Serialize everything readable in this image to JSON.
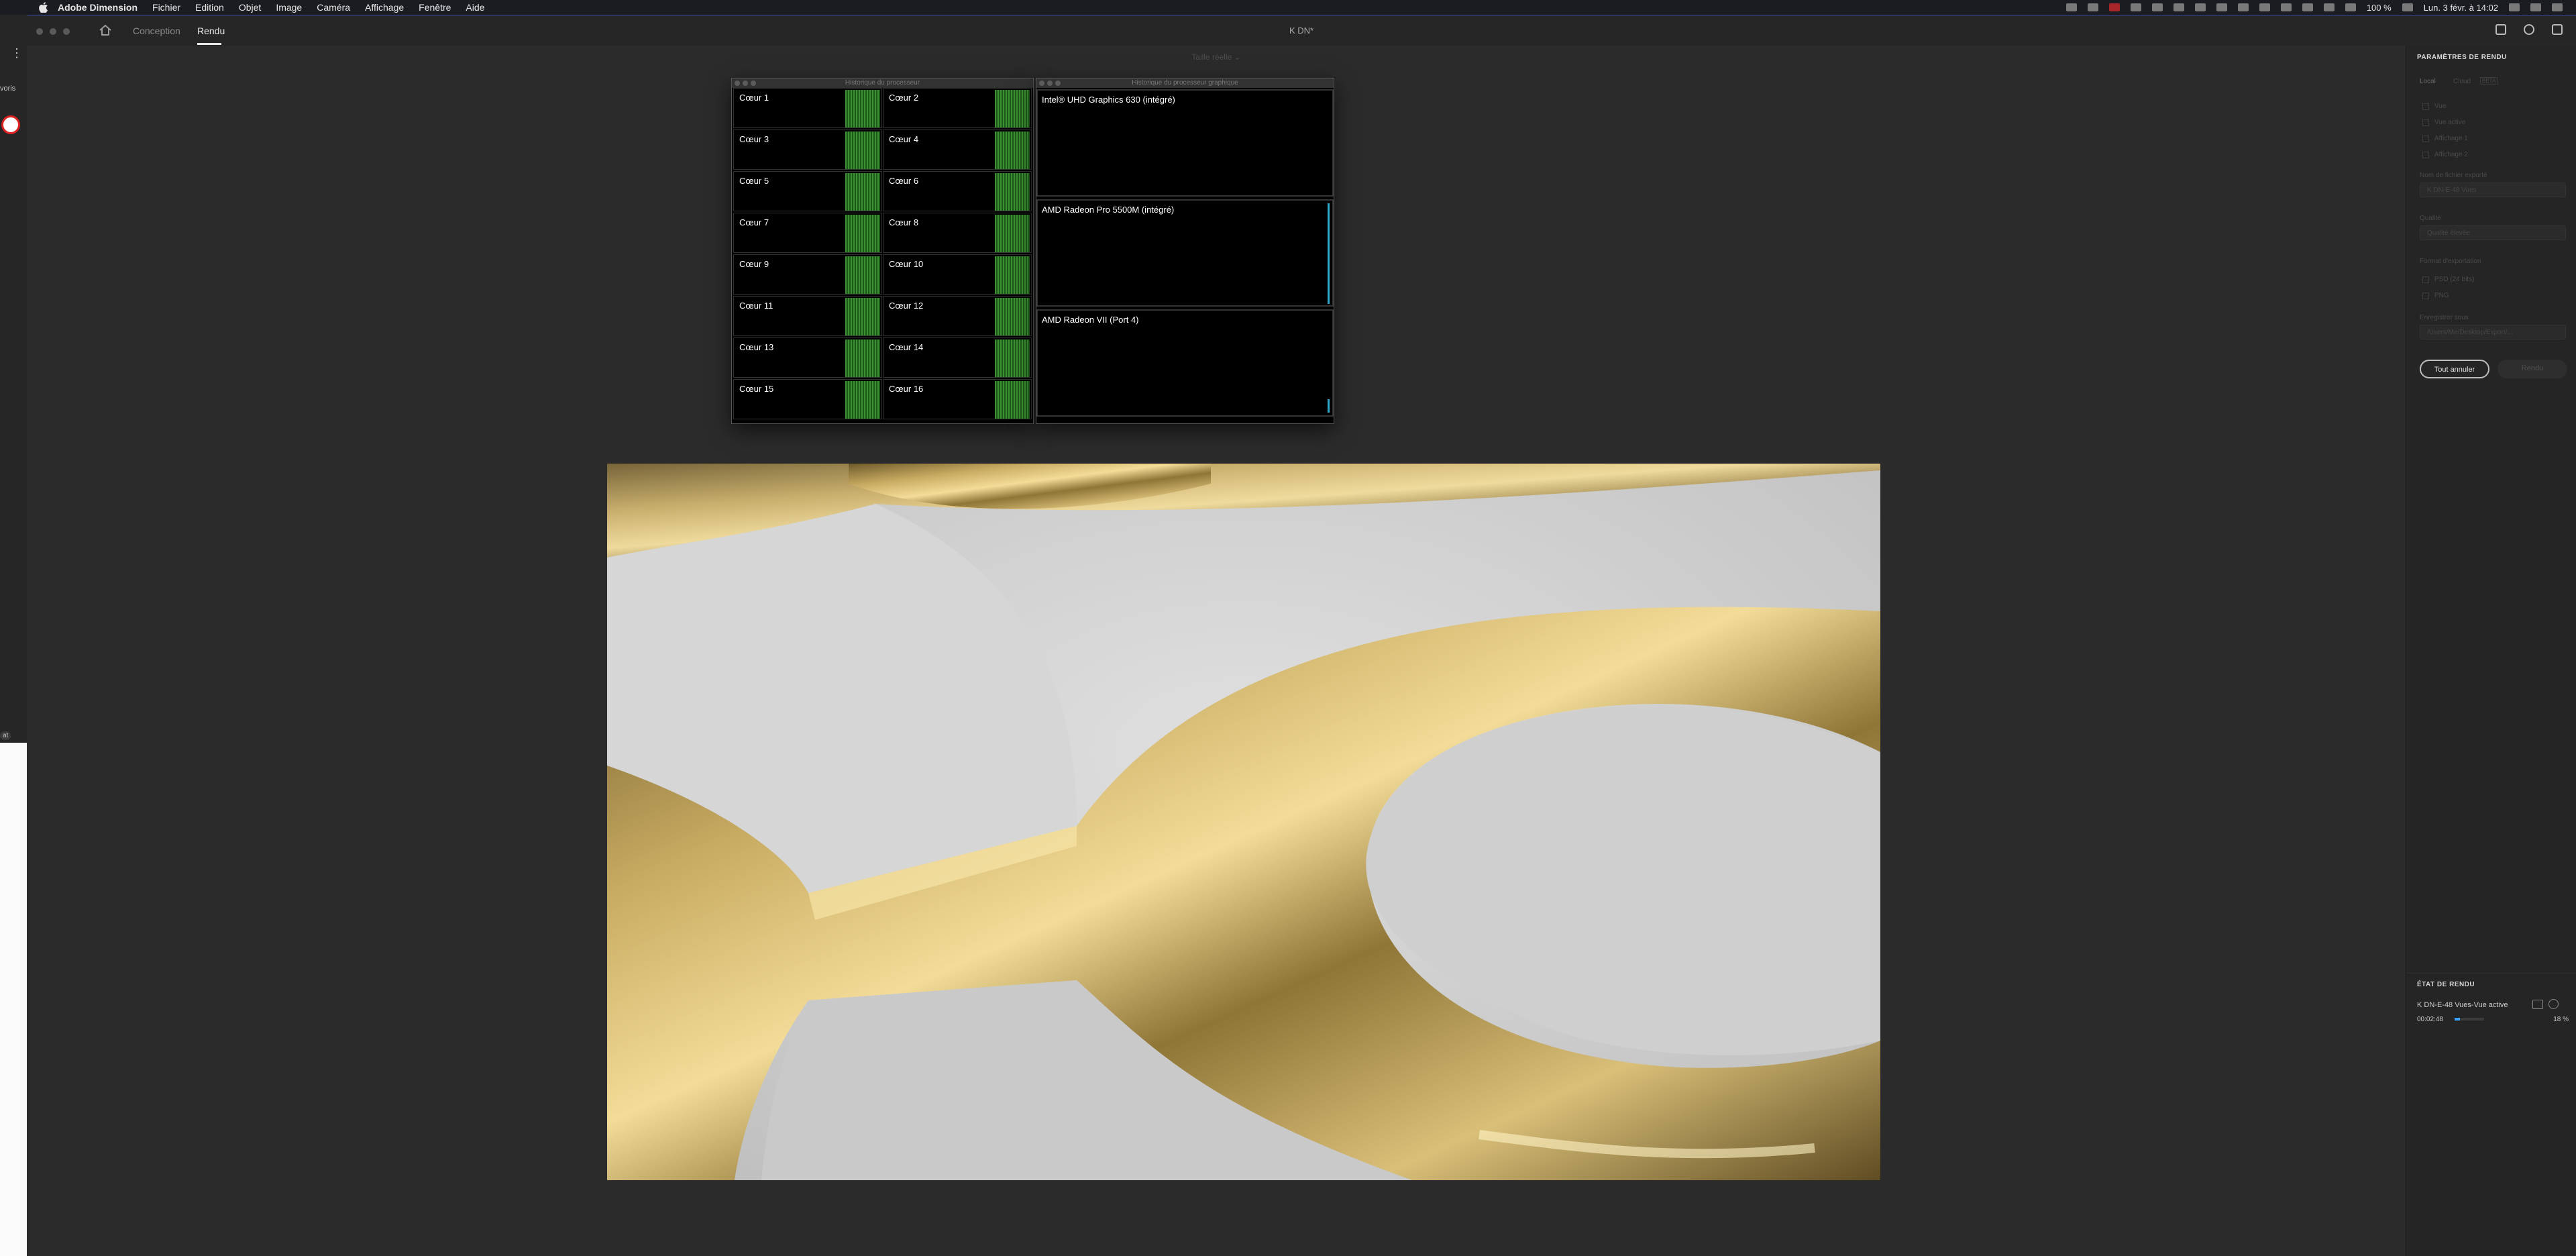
{
  "menubar": {
    "app_name": "Adobe Dimension",
    "items": [
      "Fichier",
      "Edition",
      "Objet",
      "Image",
      "Caméra",
      "Affichage",
      "Fenêtre",
      "Aide"
    ],
    "battery": "100 %",
    "datetime": "Lun. 3 févr. à 14:02"
  },
  "left_window": {
    "label": "voris",
    "badge": "at"
  },
  "header": {
    "tabs": [
      "Conception",
      "Rendu"
    ],
    "active_tab": "Rendu",
    "doc_title": "K DN*"
  },
  "subbar": {
    "text": "Taille réelle ⌄"
  },
  "cpu_monitor": {
    "title": "Historique du processeur",
    "cores": [
      "Cœur 1",
      "Cœur 2",
      "Cœur 3",
      "Cœur 4",
      "Cœur 5",
      "Cœur 6",
      "Cœur 7",
      "Cœur 8",
      "Cœur 9",
      "Cœur 10",
      "Cœur 11",
      "Cœur 12",
      "Cœur 13",
      "Cœur 14",
      "Cœur 15",
      "Cœur 16"
    ]
  },
  "gpu_monitor": {
    "title": "Historique du processeur graphique",
    "gpus": [
      "Intel® UHD Graphics 630 (intégré)",
      "AMD Radeon Pro 5500M (intégré)",
      "AMD Radeon VII (Port 4)"
    ]
  },
  "render_settings": {
    "section_title": "PARAMÈTRES DE RENDU",
    "tabs": [
      "Local",
      "Cloud"
    ],
    "cloud_badge": "BETA",
    "views": [
      "Vue",
      "Vue active",
      "Affichage 1",
      "Affichage 2"
    ],
    "file_label": "Nom de fichier exporté",
    "file_value": "K DN-E-48 Vues",
    "quality_label": "Qualité",
    "quality_value": "Qualité élevée",
    "format_label": "Format d'exportation",
    "format_psd": "PSD (24 bits)",
    "format_png": "PNG",
    "path_label": "Enregistrer sous",
    "path_value": "/Users/Me/Desktop/Export/...",
    "cancel_all": "Tout annuler",
    "render_button": "Rendu"
  },
  "render_status": {
    "section_title": "ÉTAT DE RENDU",
    "job_name": "K DN-E-48 Vues-Vue active",
    "elapsed": "00:02:48",
    "progress_percent": 18,
    "progress_label": "18 %"
  },
  "colors": {
    "accent_blue": "#3aa0ff",
    "gold": "#c2a45a",
    "cpu_green": "#3d8f33"
  }
}
